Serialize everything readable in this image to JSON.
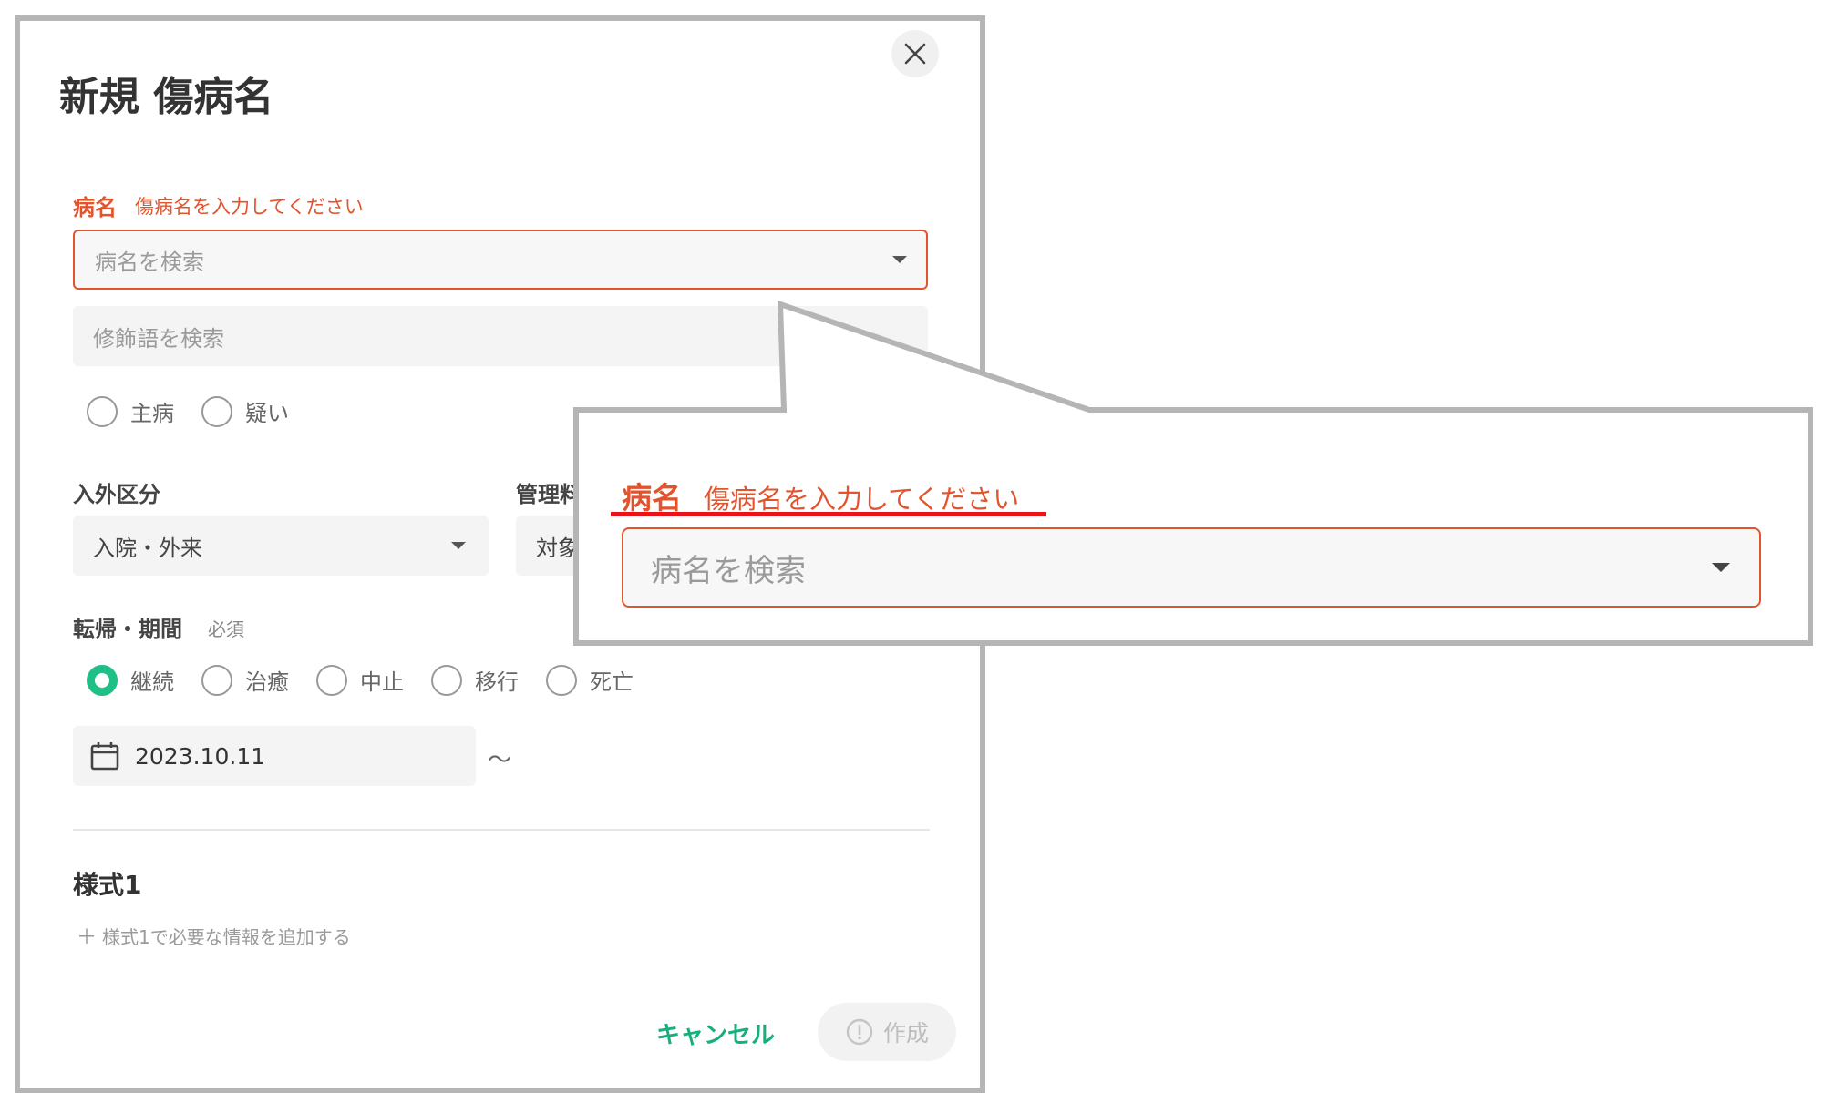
{
  "dialog": {
    "title": "新規 傷病名",
    "disease": {
      "label": "病名",
      "error": "傷病名を入力してください",
      "placeholder": "病名を検索"
    },
    "modifier": {
      "placeholder": "修飾語を検索"
    },
    "flags": {
      "options": [
        "主病",
        "疑い"
      ]
    },
    "inout": {
      "label": "入外区分",
      "value": "入院・外来"
    },
    "management": {
      "label": "管理料",
      "value": "対象"
    },
    "outcome": {
      "label": "転帰・期間",
      "required": "必須",
      "options": [
        "継続",
        "治癒",
        "中止",
        "移行",
        "死亡"
      ],
      "selected_index": 0,
      "start_date": "2023.10.11",
      "range_sep": "～"
    },
    "form1": {
      "title": "様式1",
      "add_text": "様式1で必要な情報を追加する",
      "add_symbol": "＋"
    },
    "footer": {
      "cancel": "キャンセル",
      "create": "作成"
    }
  },
  "zoom": {
    "label": "病名",
    "error": "傷病名を入力してください",
    "placeholder": "病名を検索"
  },
  "colors": {
    "error": "#e2542e",
    "accent": "#1fbf85",
    "callout_border": "#b5b5b5",
    "underline": "#e8141a"
  }
}
